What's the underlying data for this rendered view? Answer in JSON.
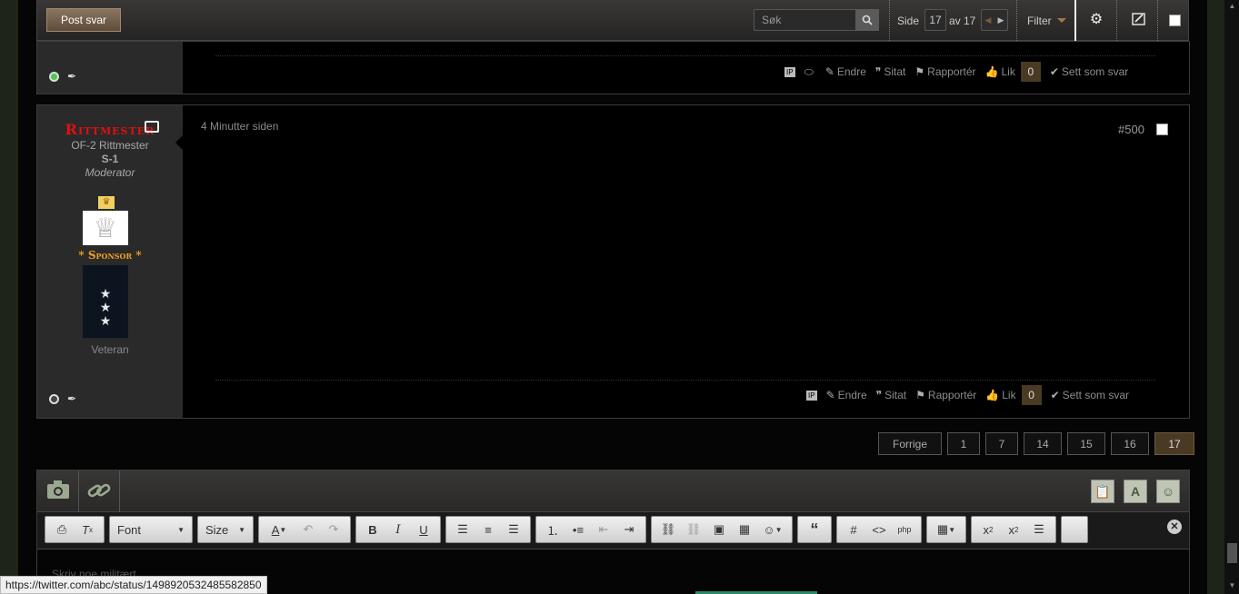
{
  "toolbar": {
    "post_reply": "Post svar",
    "search_placeholder": "Søk",
    "page_label": "Side",
    "current_page": "17",
    "of_label": "av 17",
    "filter_label": "Filter"
  },
  "post1": {
    "actions": {
      "edit": "Endre",
      "quote": "Sitat",
      "report": "Rapportér",
      "like": "Lik",
      "like_count": "0",
      "mark_answer": "Sett som svar"
    }
  },
  "post2": {
    "username": "Rittmester",
    "rank_title": "OF-2 Rittmester",
    "unit": "S-1",
    "role": "Moderator",
    "sponsor": "* Sponsor *",
    "veteran": "Veteran",
    "time_ago": "4 Minutter siden",
    "post_number": "#500",
    "actions": {
      "edit": "Endre",
      "quote": "Sitat",
      "report": "Rapportér",
      "like": "Lik",
      "like_count": "0",
      "mark_answer": "Sett som svar"
    }
  },
  "pagination": {
    "prev": "Forrige",
    "pages": [
      "1",
      "7",
      "14",
      "15",
      "16",
      "17"
    ]
  },
  "editor": {
    "font_select": "Font",
    "size_select": "Size",
    "placeholder": "Skriv noe militært..."
  },
  "status_url": "https://twitter.com/abc/status/1498920532485582850",
  "colors": {
    "accent_brown": "#4a3a24",
    "username_red": "#e01010",
    "sponsor_orange": "#f0a020"
  }
}
